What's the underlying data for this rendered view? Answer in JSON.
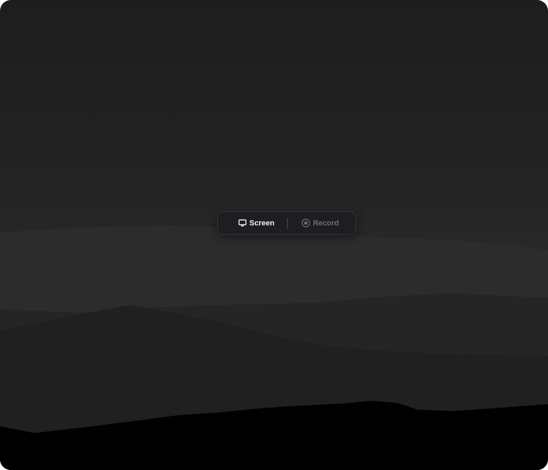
{
  "toolbar": {
    "screen_label": "Screen",
    "screen_icon": "monitor-icon",
    "record_label": "Record",
    "record_icon": "record-icon",
    "active": "screen"
  },
  "colors": {
    "background_top": "#1d1d1d",
    "background_bottom": "#000000",
    "toolbar_bg": "#1e1e22",
    "active_text": "#f2f2f4",
    "inactive_text": "#6e6e74"
  }
}
